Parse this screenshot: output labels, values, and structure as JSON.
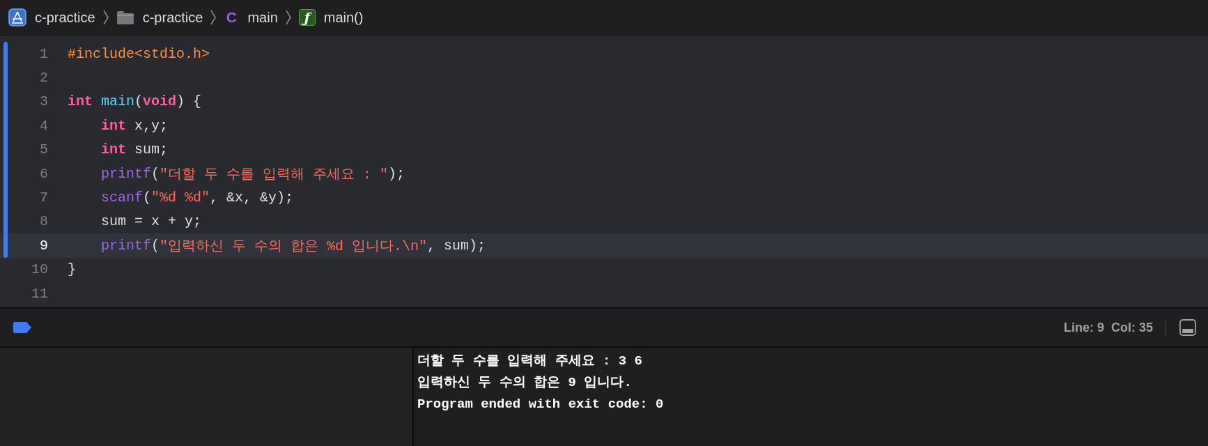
{
  "breadcrumbs": [
    {
      "kind": "project",
      "label": "c-practice"
    },
    {
      "kind": "folder",
      "label": "c-practice"
    },
    {
      "kind": "c-file",
      "glyph": "C",
      "label": "main"
    },
    {
      "kind": "function",
      "glyph": "ƒ",
      "label": "main()"
    }
  ],
  "editor": {
    "lines": [
      {
        "number": "1",
        "changed": true,
        "selected": false,
        "tokens": [
          {
            "kind": "preprocessor",
            "text": "#include<stdio.h>"
          }
        ]
      },
      {
        "number": "2",
        "changed": true,
        "selected": false
      },
      {
        "number": "3",
        "changed": true,
        "selected": false,
        "tokens": [
          {
            "kind": "keyword",
            "text": "int "
          },
          {
            "kind": "decl",
            "text": "main"
          },
          {
            "kind": "plain",
            "text": "("
          },
          {
            "kind": "keyword",
            "text": "void"
          },
          {
            "kind": "plain",
            "text": ") {"
          }
        ]
      },
      {
        "number": "4",
        "changed": true,
        "selected": false,
        "indented": true,
        "tokens": [
          {
            "kind": "keyword",
            "text": "int"
          },
          {
            "kind": "plain",
            "text": " x,y;"
          }
        ]
      },
      {
        "number": "5",
        "changed": true,
        "selected": false,
        "indented": true,
        "tokens": [
          {
            "kind": "keyword",
            "text": "int"
          },
          {
            "kind": "plain",
            "text": " sum;"
          }
        ]
      },
      {
        "number": "6",
        "changed": true,
        "selected": false,
        "indented": true,
        "tokens": [
          {
            "kind": "call",
            "text": "printf"
          },
          {
            "kind": "plain",
            "text": "("
          },
          {
            "kind": "string",
            "text": "\"더할 두 수를 입력해 주세요 : \""
          },
          {
            "kind": "plain",
            "text": ");"
          }
        ]
      },
      {
        "number": "7",
        "changed": true,
        "selected": false,
        "indented": true,
        "tokens": [
          {
            "kind": "call",
            "text": "scanf"
          },
          {
            "kind": "plain",
            "text": "("
          },
          {
            "kind": "string",
            "text": "\"%d %d\""
          },
          {
            "kind": "plain",
            "text": ", &x, &y);"
          }
        ]
      },
      {
        "number": "8",
        "changed": true,
        "selected": false,
        "indented": true,
        "tokens": [
          {
            "kind": "plain",
            "text": "sum = x + y;"
          }
        ]
      },
      {
        "number": "9",
        "changed": true,
        "selected": true,
        "indented": true,
        "tokens": [
          {
            "kind": "call",
            "text": "printf"
          },
          {
            "kind": "plain",
            "text": "("
          },
          {
            "kind": "string",
            "text": "\"입력하신 두 수의 합은 %d 입니다.\\n\""
          },
          {
            "kind": "plain",
            "text": ", sum);"
          }
        ]
      },
      {
        "number": "10",
        "changed": false,
        "selected": false,
        "tokens": [
          {
            "kind": "plain",
            "text": "}"
          }
        ]
      },
      {
        "number": "11",
        "changed": false,
        "selected": false
      }
    ]
  },
  "status_bar": {
    "line": "Line: 9",
    "column": "Col: 35"
  },
  "console": {
    "output": [
      "더할 두 수를 입력해 주세요 : 3 6",
      "입력하신 두 수의 합은 9 입니다.",
      "Program ended with exit code: 0"
    ]
  }
}
